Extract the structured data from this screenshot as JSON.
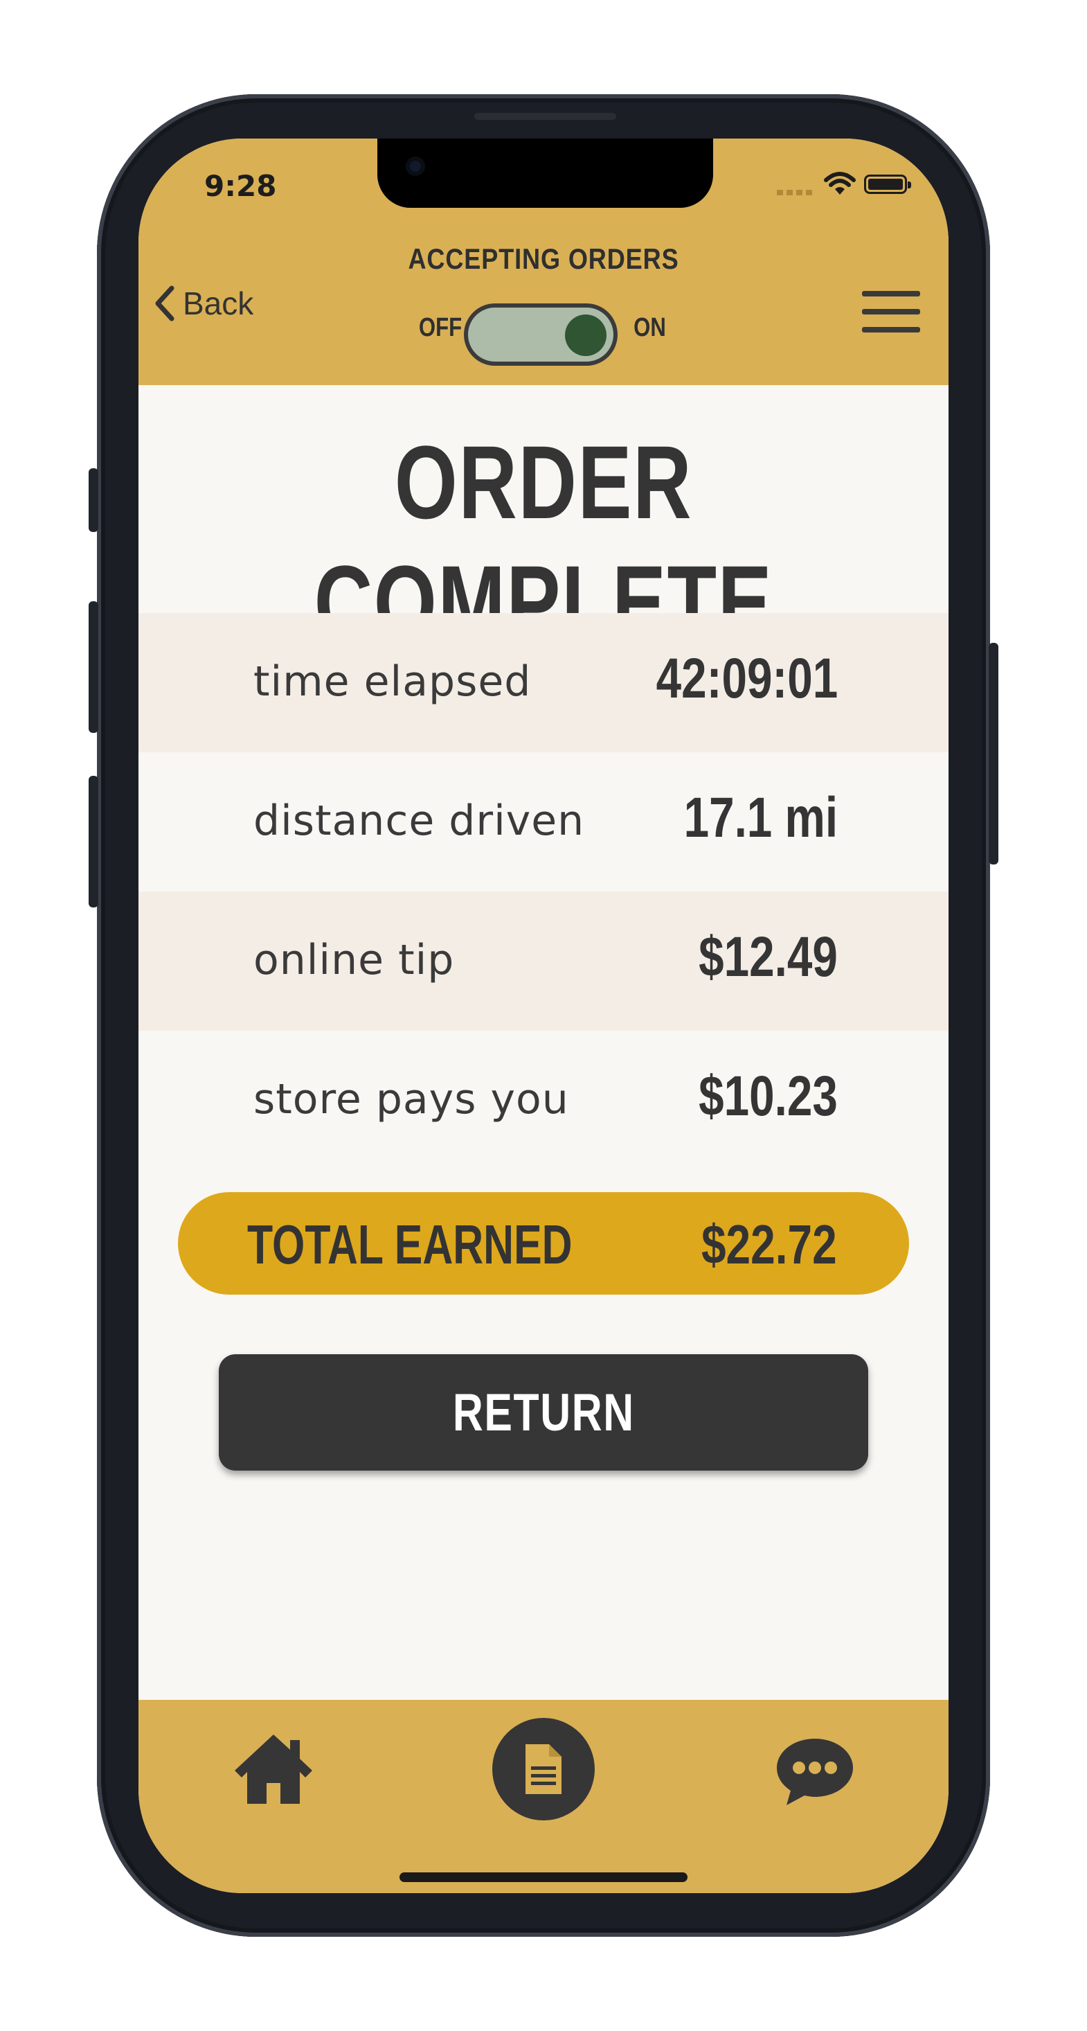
{
  "status_bar": {
    "time": "9:28"
  },
  "header": {
    "back_label": "Back",
    "accepting_label": "ACCEPTING ORDERS",
    "toggle_off_label": "OFF",
    "toggle_on_label": "ON",
    "toggle_state": "on"
  },
  "main": {
    "title": "ORDER COMPLETE",
    "rows": [
      {
        "label": "time elapsed",
        "value": "42:09:01"
      },
      {
        "label": "distance driven",
        "value": "17.1 mi"
      },
      {
        "label": "online tip",
        "value": "$12.49"
      },
      {
        "label": "store pays you",
        "value": "$10.23"
      }
    ],
    "total": {
      "label": "TOTAL EARNED",
      "value": "$22.72"
    },
    "return_label": "RETURN"
  },
  "nav": {
    "items": [
      {
        "icon": "home-icon"
      },
      {
        "icon": "document-icon",
        "active": true
      },
      {
        "icon": "chat-icon"
      }
    ]
  },
  "colors": {
    "bar": "#dab055",
    "accent": "#dea81c",
    "dark": "#363636",
    "toggle_knob": "#2f5532"
  }
}
